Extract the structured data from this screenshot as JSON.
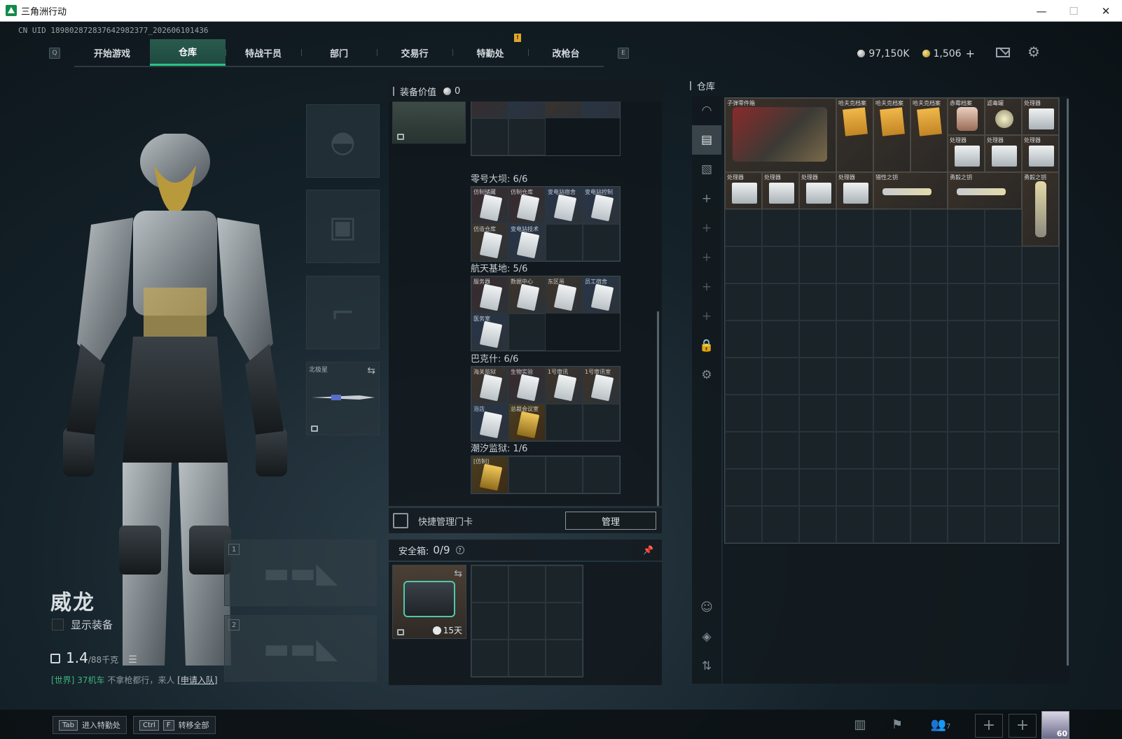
{
  "window": {
    "title": "三角洲行动",
    "minimize": "—",
    "maximize": "☐",
    "close": "✕"
  },
  "uid": "CN UID 1898028728376429823​77_202606101436",
  "nav": {
    "prev_key": "Q",
    "next_key": "E",
    "tabs": [
      {
        "label": "开始游戏"
      },
      {
        "label": "仓库",
        "active": true
      },
      {
        "label": "特战干员"
      },
      {
        "label": "部门"
      },
      {
        "label": "交易行"
      },
      {
        "label": "特勤处",
        "badge": "!"
      },
      {
        "label": "改枪台"
      }
    ]
  },
  "currency": {
    "silver": "97,150K",
    "gold": "1,506",
    "plus": "+"
  },
  "operator": {
    "name": "威龙",
    "show_equipment": "显示装备",
    "weight_value": "1.4",
    "weight_unit": "/88千克",
    "chat_channel": "[世界]",
    "chat_user": "37机车",
    "chat_message": "不拿枪都行，来人",
    "chat_link": "[申请入队]"
  },
  "equipment": {
    "melee_label": "北极星",
    "slot1": "1",
    "slot2": "2"
  },
  "center": {
    "equip_value_label": "装备价值",
    "equip_value": "0",
    "maps": [
      {
        "title": "零号大坝: 6/6",
        "cells": [
          {
            "name": "仿制储藏",
            "color": "red"
          },
          {
            "name": "仿制仓库",
            "color": "red"
          },
          {
            "name": "变电站宿舍",
            "color": "blue"
          },
          {
            "name": "变电站控制",
            "color": "blue"
          },
          {
            "name": "仿造仓库",
            "color": "brown"
          },
          {
            "name": "变电站技术",
            "color": "blue"
          }
        ],
        "total": 8
      },
      {
        "title": "航天基地: 5/6",
        "cells": [
          {
            "name": "服务器",
            "color": "red"
          },
          {
            "name": "数据中心",
            "color": "brown"
          },
          {
            "name": "东区吊",
            "color": "brown"
          },
          {
            "name": "员工宿舍",
            "color": "blue"
          },
          {
            "name": "医务室",
            "color": "blue"
          }
        ],
        "total": 6
      },
      {
        "title": "巴克什: 6/6",
        "cells": [
          {
            "name": "海关监狱",
            "color": "brown"
          },
          {
            "name": "生物实验",
            "color": "red"
          },
          {
            "name": "1号审讯",
            "color": "brown"
          },
          {
            "name": "1号审讯室",
            "color": "brown"
          },
          {
            "name": "浴店",
            "color": "blue"
          },
          {
            "name": "总裁会议室",
            "color": "gold"
          }
        ],
        "total": 8
      },
      {
        "title": "潮汐监狱: 1/6",
        "cells": [
          {
            "name": "[仿制]",
            "color": "gold"
          }
        ],
        "total": 4
      }
    ],
    "quick_card_label": "快捷管理门卡",
    "manage_button": "管理",
    "safe_box_label": "安全箱:",
    "safe_box_count": "0/9",
    "safe_box_help": "?",
    "safe_box_days": "15天"
  },
  "warehouse": {
    "title": "仓库",
    "items": [
      {
        "name": "子弹零件箱",
        "art": "kit",
        "col": 1,
        "row": 1,
        "w": 3,
        "h": 2
      },
      {
        "name": "哈夫克档案",
        "art": "doc",
        "col": 4,
        "row": 1,
        "w": 1,
        "h": 2
      },
      {
        "name": "哈夫克档案",
        "art": "doc",
        "col": 5,
        "row": 1,
        "w": 1,
        "h": 2
      },
      {
        "name": "哈夫克档案",
        "art": "doc",
        "col": 6,
        "row": 1,
        "w": 1,
        "h": 2
      },
      {
        "name": "赤霉档案",
        "art": "jar",
        "col": 7,
        "row": 1,
        "w": 1,
        "h": 1
      },
      {
        "name": "滤毒罐",
        "art": "gas",
        "col": 8,
        "row": 1,
        "w": 1,
        "h": 1
      },
      {
        "name": "处理器",
        "art": "device",
        "col": 9,
        "row": 1,
        "w": 1,
        "h": 1
      },
      {
        "name": "处理器",
        "art": "device",
        "col": 7,
        "row": 2,
        "w": 1,
        "h": 1
      },
      {
        "name": "处理器",
        "art": "device",
        "col": 8,
        "row": 2,
        "w": 1,
        "h": 1
      },
      {
        "name": "处理器",
        "art": "device",
        "col": 9,
        "row": 2,
        "w": 1,
        "h": 1
      },
      {
        "name": "处理器",
        "art": "device",
        "col": 1,
        "row": 3,
        "w": 1,
        "h": 1
      },
      {
        "name": "处理器",
        "art": "device",
        "col": 2,
        "row": 3,
        "w": 1,
        "h": 1
      },
      {
        "name": "处理器",
        "art": "device",
        "col": 3,
        "row": 3,
        "w": 1,
        "h": 1
      },
      {
        "name": "处理器",
        "art": "device",
        "col": 4,
        "row": 3,
        "w": 1,
        "h": 1
      },
      {
        "name": "猎性之钥",
        "art": "key",
        "col": 5,
        "row": 3,
        "w": 2,
        "h": 1
      },
      {
        "name": "勇毅之钥",
        "art": "key",
        "col": 7,
        "row": 3,
        "w": 2,
        "h": 1
      },
      {
        "name": "勇毅之钥",
        "art": "keyv",
        "col": 9,
        "row": 3,
        "w": 1,
        "h": 2
      }
    ],
    "rows": 12,
    "cols": 9
  },
  "bottom": {
    "tab_key": "Tab",
    "tab_label": "进入特勤处",
    "ctrl_key": "Ctrl",
    "f_key": "F",
    "ctrl_label": "转移全部",
    "friends_count": "7",
    "level": "60"
  }
}
